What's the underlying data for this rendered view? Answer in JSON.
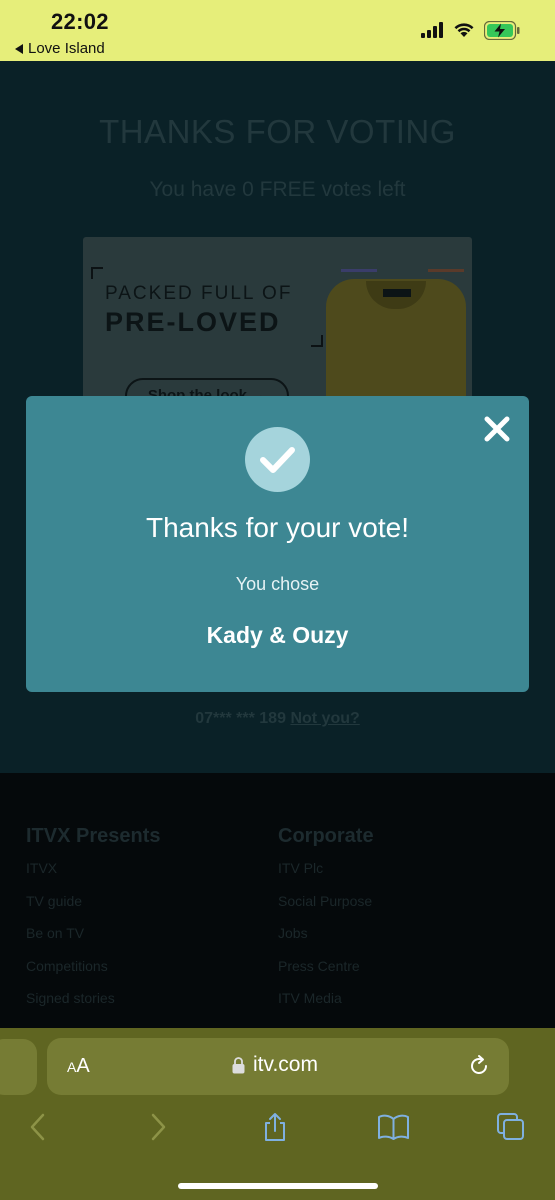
{
  "status_bar": {
    "time": "22:02",
    "back_app": "Love Island"
  },
  "page": {
    "title": "THANKS FOR VOTING",
    "votes_left": "You have 0 FREE votes left",
    "ad": {
      "line1": "PACKED FULL OF",
      "line2": "PRE-LOVED",
      "button": "Shop the look →"
    },
    "phone_masked": "07*** *** 189",
    "not_you": "Not you?"
  },
  "footer": {
    "col1": {
      "heading": "ITVX Presents",
      "links": [
        "ITVX",
        "TV guide",
        "Be on TV",
        "Competitions",
        "Signed stories"
      ]
    },
    "col2": {
      "heading": "Corporate",
      "links": [
        "ITV Plc",
        "Social Purpose",
        "Jobs",
        "Press Centre",
        "ITV Media"
      ]
    }
  },
  "modal": {
    "title": "Thanks for your vote!",
    "subtitle": "You chose",
    "choice": "Kady & Ouzy",
    "icons": {
      "close": "close-icon",
      "check": "check-icon"
    }
  },
  "browser": {
    "text_size_small": "A",
    "text_size_large": "A",
    "url": "itv.com"
  },
  "colors": {
    "status_bar": "#e6ee7a",
    "modal_bg": "#3d8793",
    "toolbar_bg": "#5f6521",
    "page_bg": "#0a2127"
  }
}
